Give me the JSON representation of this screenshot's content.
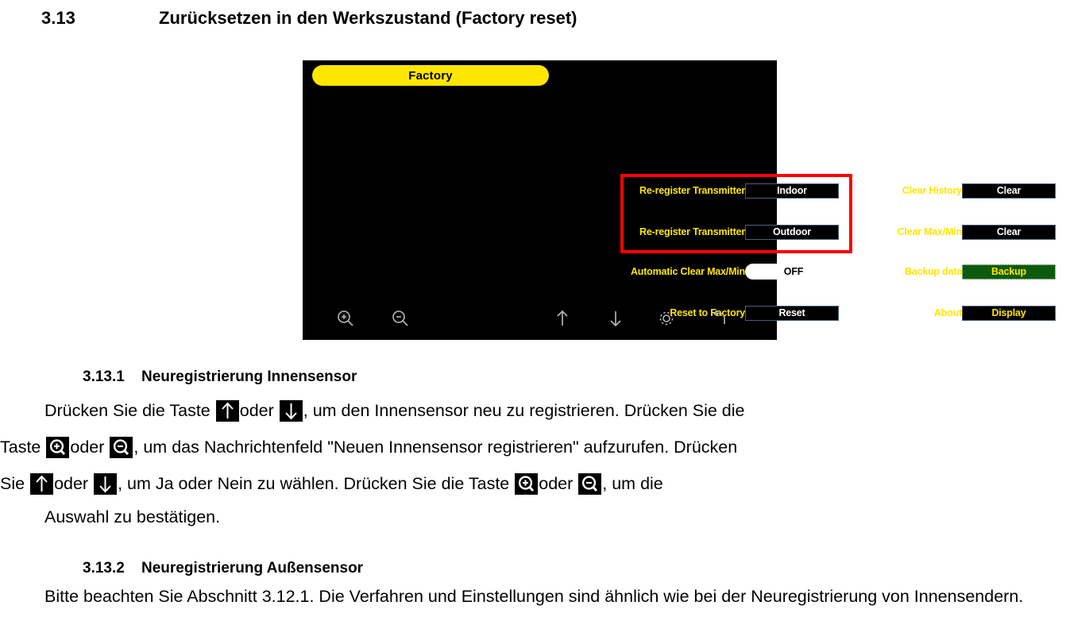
{
  "document": {
    "section": {
      "number": "3.13",
      "title": "Zurücksetzen in den Werkszustand (Factory reset)"
    },
    "subsections": [
      {
        "number": "3.13.1",
        "title": "Neuregistrierung Innensensor",
        "lines": [
          "Drücken Sie die Taste ↑oder ↓, um den Innensensor neu zu registrieren. Drücken Sie die",
          "Taste ⊕ oder ⊖, um das Nachrichtenfeld \"Neuen Innensensor registrieren\" aufzurufen. Drücken",
          "Sie ↑ oder ↓, um Ja oder Nein zu wählen. Drücken Sie die Taste ⊕ oder ⊖, um die",
          "Auswahl zu bestätigen."
        ],
        "line1_a": "Drücken Sie die Taste",
        "line1_b": "oder",
        "line1_c": ", um den Innensensor neu zu registrieren. Drücken Sie die",
        "line2_a": "Taste",
        "line2_b": "oder",
        "line2_c": ", um das Nachrichtenfeld \"Neuen Innensensor registrieren\" aufzurufen. Drücken",
        "line3_a": "Sie",
        "line3_b": "oder",
        "line3_c": ", um Ja oder Nein zu wählen. Drücken Sie die Taste",
        "line3_d": "oder",
        "line3_e": ", um die",
        "line4": "Auswahl zu bestätigen."
      },
      {
        "number": "3.13.2",
        "title": "Neuregistrierung Außensensor",
        "body": "Bitte beachten Sie Abschnitt 3.12.1. Die Verfahren und Einstellungen sind ähnlich wie bei der Neuregistrierung von Innensendern."
      }
    ]
  },
  "device_screen": {
    "title": "Factory",
    "title_bg_color": "#ffe600",
    "label_color": "#ffe600",
    "value_color": "#ffffff",
    "background_color": "#000000",
    "annotation_box_color": "#ff0000",
    "rows_left": [
      {
        "label": "Re-register Transmitter",
        "value": "Indoor",
        "style": "box"
      },
      {
        "label": "Re-register Transmitter",
        "value": "Outdoor",
        "style": "box"
      },
      {
        "label": "Automatic Clear Max/Min",
        "value": "OFF",
        "style": "pill"
      },
      {
        "label": "Reset to Factory",
        "value": "Reset",
        "style": "box"
      }
    ],
    "rows_right": [
      {
        "label": "Clear History",
        "value": "Clear",
        "style": "box"
      },
      {
        "label": "Clear Max/Min",
        "value": "Clear",
        "style": "box"
      },
      {
        "label": "Backup data",
        "value": "Backup",
        "style": "selected"
      },
      {
        "label": "About",
        "value": "Display",
        "style": "box-yellow"
      }
    ],
    "toolbar_icons": [
      "zoom-in-icon",
      "zoom-out-icon",
      "arrow-up-icon",
      "arrow-down-icon",
      "gear-icon",
      "back-icon"
    ]
  }
}
